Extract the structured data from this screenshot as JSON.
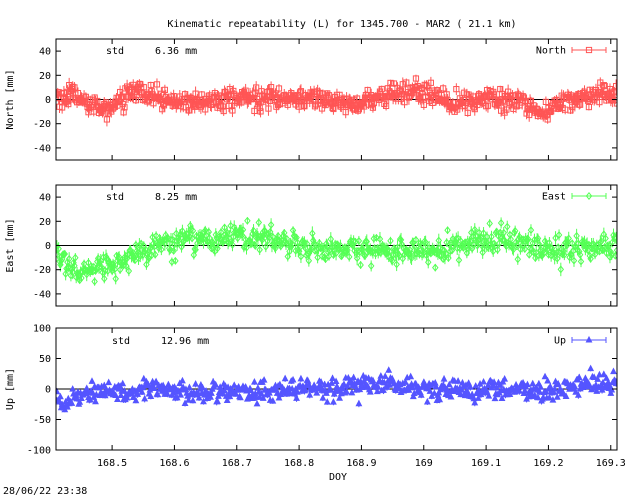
{
  "title": "Kinematic repeatability (L) for 1345.700 - MAR2  ( 21.1 km)",
  "footer_timestamp": "28/06/22 23:38",
  "chart_data": [
    {
      "type": "scatter",
      "title": "",
      "ylabel": "North [mm]",
      "xlabel": "",
      "ylim": [
        -50,
        50
      ],
      "yticks": [
        -40,
        -20,
        0,
        20,
        40
      ],
      "xlim": [
        168.41,
        169.31
      ],
      "grid": false,
      "legend_position": "top-right",
      "annotation": {
        "label": "std",
        "value": "6.36 mm"
      },
      "series": [
        {
          "name": "North",
          "color": "#ff5555",
          "marker": "square",
          "errorbars": true,
          "std_mm": 6.36,
          "description": "noisy series oscillating roughly between -20 and +20 mm around 0",
          "anchors": [
            [
              168.41,
              3
            ],
            [
              168.44,
              2
            ],
            [
              168.47,
              -6
            ],
            [
              168.5,
              -5
            ],
            [
              168.53,
              6
            ],
            [
              168.56,
              2
            ],
            [
              168.6,
              -2
            ],
            [
              168.65,
              -3
            ],
            [
              168.7,
              0
            ],
            [
              168.75,
              2
            ],
            [
              168.8,
              1
            ],
            [
              168.85,
              0
            ],
            [
              168.89,
              -6
            ],
            [
              168.92,
              0
            ],
            [
              168.97,
              9
            ],
            [
              169.0,
              4
            ],
            [
              169.05,
              -3
            ],
            [
              169.1,
              0
            ],
            [
              169.15,
              -1
            ],
            [
              169.19,
              -11
            ],
            [
              169.22,
              -2
            ],
            [
              169.27,
              3
            ],
            [
              169.31,
              5
            ]
          ]
        }
      ]
    },
    {
      "type": "scatter",
      "title": "",
      "ylabel": "East [mm]",
      "xlabel": "",
      "ylim": [
        -50,
        50
      ],
      "yticks": [
        -40,
        -20,
        0,
        20,
        40
      ],
      "xlim": [
        168.41,
        169.31
      ],
      "grid": false,
      "legend_position": "top-right",
      "annotation": {
        "label": "std",
        "value": "8.25 mm"
      },
      "series": [
        {
          "name": "East",
          "color": "#55ff55",
          "marker": "diamond",
          "errorbars": true,
          "std_mm": 8.25,
          "description": "dips to about -20 mm near day 168.45, rises above 0 from 168.58 to 168.75, hovers below 0 afterwards",
          "anchors": [
            [
              168.41,
              -6
            ],
            [
              168.43,
              -16
            ],
            [
              168.46,
              -22
            ],
            [
              168.5,
              -15
            ],
            [
              168.54,
              -8
            ],
            [
              168.58,
              3
            ],
            [
              168.62,
              6
            ],
            [
              168.66,
              5
            ],
            [
              168.7,
              8
            ],
            [
              168.74,
              6
            ],
            [
              168.78,
              2
            ],
            [
              168.82,
              -1
            ],
            [
              168.86,
              -3
            ],
            [
              168.9,
              -5
            ],
            [
              168.95,
              -5
            ],
            [
              169.0,
              -3
            ],
            [
              169.05,
              0
            ],
            [
              169.1,
              5
            ],
            [
              169.15,
              2
            ],
            [
              169.2,
              -3
            ],
            [
              169.25,
              -2
            ],
            [
              169.31,
              -1
            ]
          ]
        }
      ]
    },
    {
      "type": "scatter",
      "title": "",
      "ylabel": "Up [mm]",
      "xlabel": "DOY",
      "ylim": [
        -100,
        100
      ],
      "yticks": [
        -100,
        -50,
        0,
        50,
        100
      ],
      "xlim": [
        168.41,
        169.31
      ],
      "xticks": [
        168.5,
        168.6,
        168.7,
        168.8,
        168.9,
        169,
        169.1,
        169.2,
        169.3
      ],
      "xtick_labels": [
        "168.5",
        "168.6",
        "168.7",
        "168.8",
        "168.9",
        "169",
        "169.1",
        "169.2",
        "169.3"
      ],
      "grid": false,
      "legend_position": "top-right",
      "annotation": {
        "label": "std",
        "value": "12.96 mm"
      },
      "series": [
        {
          "name": "Up",
          "color": "#5555ff",
          "marker": "triangle",
          "errorbars": true,
          "std_mm": 12.96,
          "description": "noisy series mostly between -30 and +30 mm, deeper dips near day 168.42",
          "anchors": [
            [
              168.41,
              -8
            ],
            [
              168.42,
              -30
            ],
            [
              168.44,
              -12
            ],
            [
              168.47,
              -2
            ],
            [
              168.5,
              -6
            ],
            [
              168.55,
              -2
            ],
            [
              168.6,
              -5
            ],
            [
              168.65,
              -6
            ],
            [
              168.7,
              -2
            ],
            [
              168.75,
              -4
            ],
            [
              168.8,
              -1
            ],
            [
              168.85,
              0
            ],
            [
              168.9,
              6
            ],
            [
              168.95,
              10
            ],
            [
              169.0,
              -2
            ],
            [
              169.05,
              0
            ],
            [
              169.08,
              -8
            ],
            [
              169.1,
              2
            ],
            [
              169.15,
              -3
            ],
            [
              169.2,
              -4
            ],
            [
              169.25,
              5
            ],
            [
              169.31,
              8
            ]
          ]
        }
      ]
    }
  ]
}
